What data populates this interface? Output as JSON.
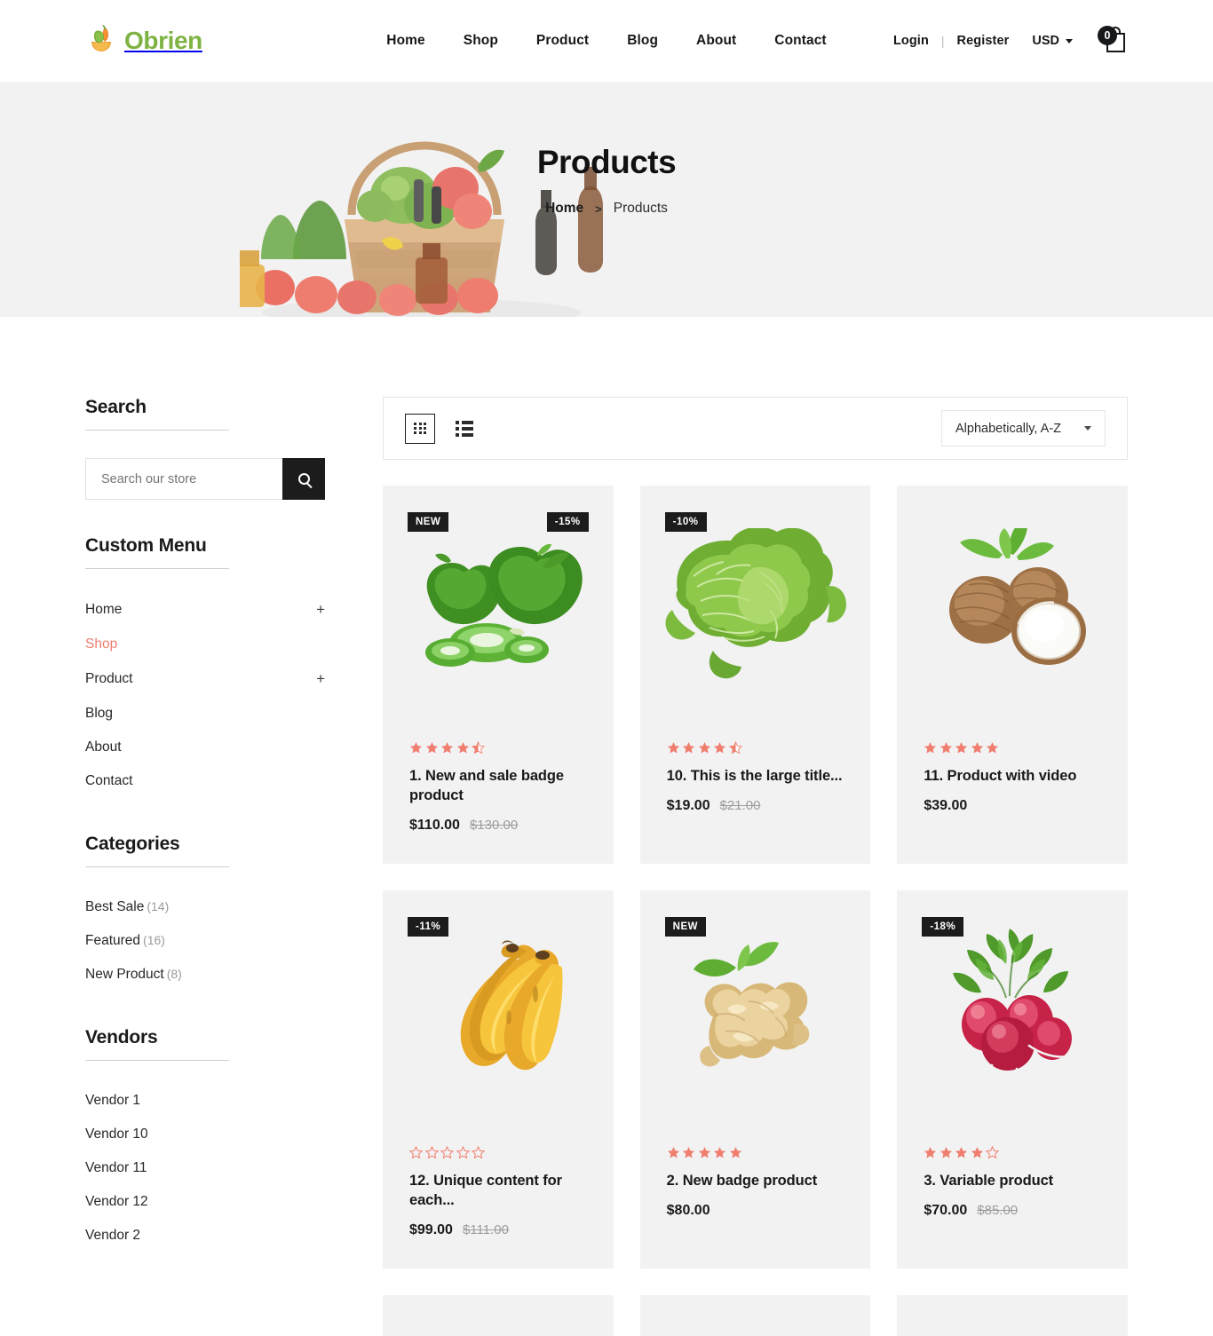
{
  "header": {
    "brand": "Obrien",
    "brand_icon": "vegetable-bowl-logo",
    "nav": [
      {
        "label": "Home"
      },
      {
        "label": "Shop"
      },
      {
        "label": "Product"
      },
      {
        "label": "Blog"
      },
      {
        "label": "About"
      },
      {
        "label": "Contact"
      }
    ],
    "login": "Login",
    "separator": "|",
    "register": "Register",
    "currency": "USD",
    "cart_count": "0"
  },
  "hero": {
    "title": "Products",
    "breadcrumb_home": "Home",
    "breadcrumb_sep": ">",
    "breadcrumb_current": "Products",
    "background": "#f2f2f2"
  },
  "sidebar": {
    "search": {
      "title": "Search",
      "placeholder": "Search our store",
      "value": "",
      "button_icon": "search-icon"
    },
    "custom_menu": {
      "title": "Custom Menu",
      "items": [
        {
          "label": "Home",
          "expander": "+",
          "active": false
        },
        {
          "label": "Shop",
          "expander": "",
          "active": true
        },
        {
          "label": "Product",
          "expander": "+",
          "active": false
        },
        {
          "label": "Blog",
          "expander": "",
          "active": false
        },
        {
          "label": "About",
          "expander": "",
          "active": false
        },
        {
          "label": "Contact",
          "expander": "",
          "active": false
        }
      ]
    },
    "categories": {
      "title": "Categories",
      "items": [
        {
          "label": "Best Sale",
          "count": "(14)"
        },
        {
          "label": "Featured",
          "count": "(16)"
        },
        {
          "label": "New Product",
          "count": "(8)"
        }
      ]
    },
    "vendors": {
      "title": "Vendors",
      "items": [
        {
          "label": "Vendor 1"
        },
        {
          "label": "Vendor 10"
        },
        {
          "label": "Vendor 11"
        },
        {
          "label": "Vendor 12"
        },
        {
          "label": "Vendor 2"
        }
      ]
    }
  },
  "toolbar": {
    "grid_view_icon": "grid-view-icon",
    "list_view_icon": "list-view-icon",
    "active_view": "grid",
    "sort_value": "Alphabetically, A-Z"
  },
  "colors": {
    "accent": "#ef7e6e",
    "brand_green": "#7eb343",
    "badge_bg": "#1c1c1c",
    "card_bg": "#f2f2f2"
  },
  "products": [
    {
      "title": "1. New and sale badge product",
      "price": "$110.00",
      "compare_price": "$130.00",
      "rating": 4.5,
      "badge_left": "NEW",
      "badge_right": "-15%",
      "image": "green-bell-peppers"
    },
    {
      "title": "10. This is the large title...",
      "price": "$19.00",
      "compare_price": "$21.00",
      "rating": 4.5,
      "badge_left": "-10%",
      "badge_right": "",
      "image": "savoy-cabbage"
    },
    {
      "title": "11. Product with video",
      "price": "$39.00",
      "compare_price": "",
      "rating": 5,
      "badge_left": "",
      "badge_right": "",
      "image": "coconuts"
    },
    {
      "title": "12. Unique content for each...",
      "price": "$99.00",
      "compare_price": "$111.00",
      "rating": 0,
      "badge_left": "-11%",
      "badge_right": "",
      "image": "bananas"
    },
    {
      "title": "2. New badge product",
      "price": "$80.00",
      "compare_price": "",
      "rating": 5,
      "badge_left": "NEW",
      "badge_right": "",
      "image": "ginger-root"
    },
    {
      "title": "3. Variable product",
      "price": "$70.00",
      "compare_price": "$85.00",
      "rating": 4,
      "badge_left": "-18%",
      "badge_right": "",
      "image": "radishes"
    }
  ]
}
